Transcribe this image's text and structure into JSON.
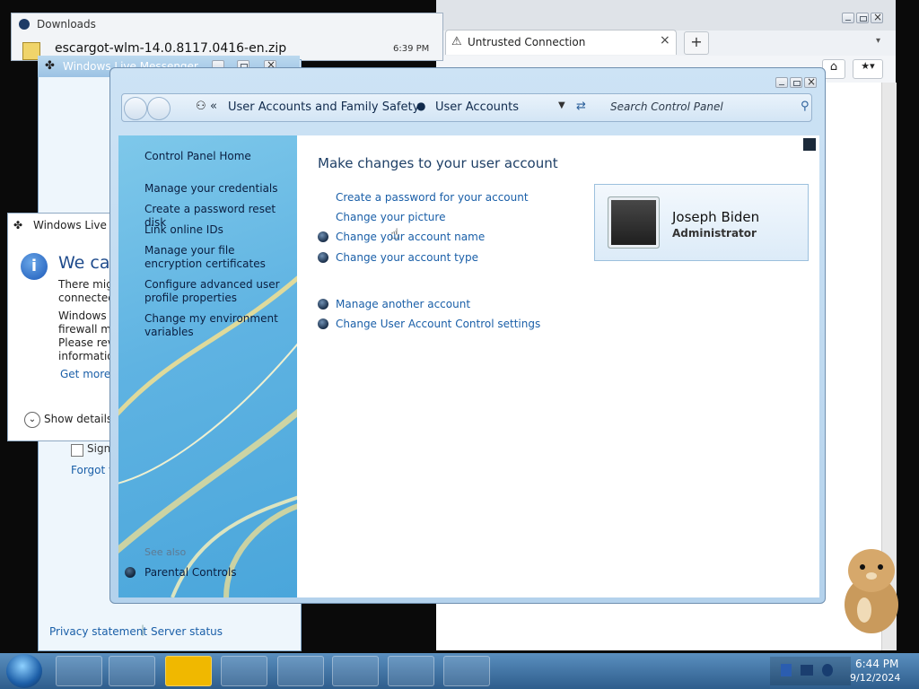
{
  "downloads": {
    "title": "Downloads",
    "file_name": "escargot-wlm-14.0.8117.0416-en.zip",
    "file_time": "6:39 PM"
  },
  "browser": {
    "tab_title": "Untrusted Connection",
    "new_tab_label": "+"
  },
  "windows_live_back": {
    "title": "Windows Live Messenger",
    "sign_label": "Sign",
    "forgot_label": "Forgot y",
    "privacy": "Privacy statement",
    "server_status": "Server status"
  },
  "windows_live_msg": {
    "title": "Windows Live M",
    "heading": "We can",
    "line1": "There migh",
    "line2": "connected",
    "line3": "Windows L",
    "line4": "firewall ma",
    "line5": "Please revi",
    "line6": "informatio",
    "get_more": "Get more i",
    "show_details": "Show details"
  },
  "control_panel": {
    "breadcrumb": {
      "sep": "«",
      "item1": "User Accounts and Family Safety",
      "item2": "User Accounts"
    },
    "search_placeholder": "Search Control Panel",
    "sidebar": {
      "home": "Control Panel Home",
      "items": [
        "Manage your credentials",
        "Create a password reset disk",
        "Link online IDs",
        "Manage your file encryption certificates",
        "Configure advanced user profile properties",
        "Change my environment variables"
      ],
      "see_also": "See also",
      "parental": "Parental Controls"
    },
    "main": {
      "heading": "Make changes to your user account",
      "links_group1": [
        "Create a password for your account",
        "Change your picture",
        "Change your account name",
        "Change your account type"
      ],
      "links_group2": [
        "Manage another account",
        "Change User Account Control settings"
      ]
    },
    "account": {
      "name": "Joseph Biden",
      "role": "Administrator"
    }
  },
  "taskbar": {
    "time": "6:44 PM",
    "date": "9/12/2024",
    "icons": [
      "start-orb-icon",
      "monitor-icon",
      "media-player-icon",
      "globe-icon",
      "firefox-icon",
      "7zip-icon",
      "wand-icon",
      "messenger-icon",
      "network-monitor-icon"
    ]
  },
  "colors": {
    "accent_link": "#1a5fa8",
    "sidebar_top": "#7ec8ea",
    "taskbar": "#2e5d8c"
  }
}
